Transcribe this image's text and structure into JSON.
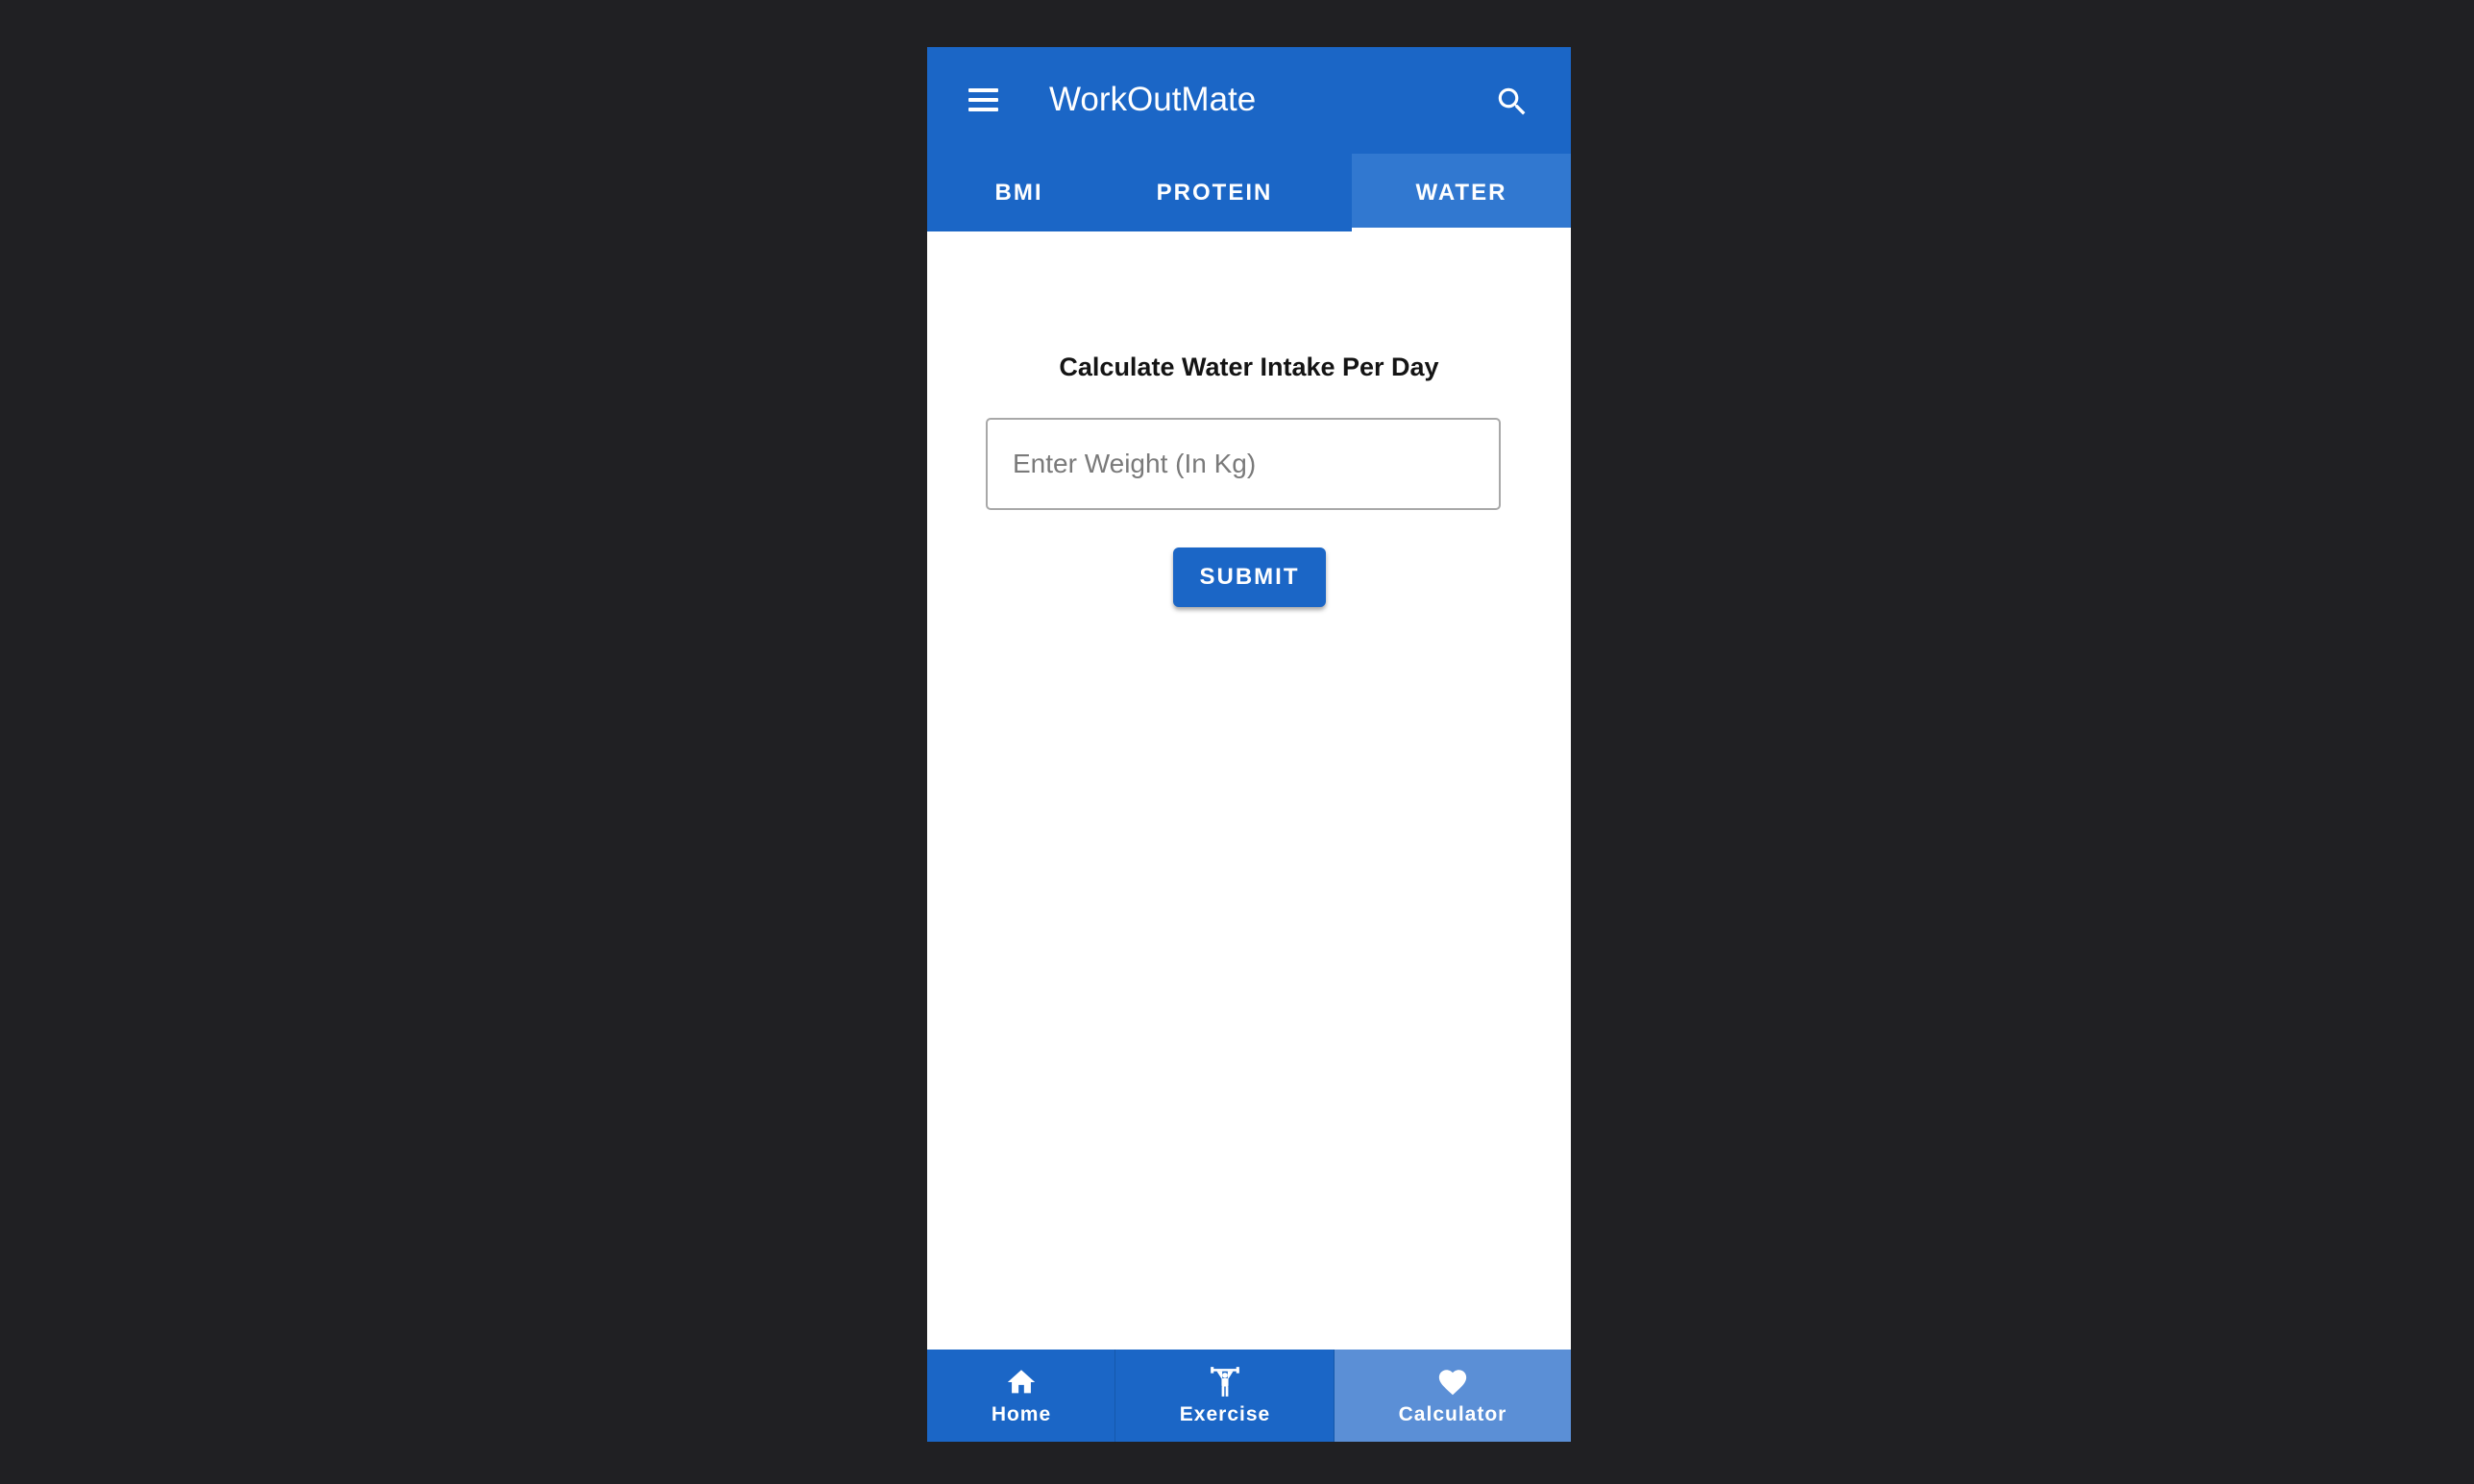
{
  "app": {
    "title": "WorkOutMate",
    "menu_icon": "menu-icon",
    "search_icon": "search-icon"
  },
  "tabs": [
    {
      "label": "BMI",
      "active": false
    },
    {
      "label": "PROTEIN",
      "active": false
    },
    {
      "label": "WATER",
      "active": true
    }
  ],
  "water": {
    "heading": "Calculate Water Intake Per Day",
    "weight_placeholder": "Enter Weight (In Kg)",
    "weight_value": "",
    "submit_label": "SUBMIT"
  },
  "bottom_nav": [
    {
      "label": "Home",
      "icon": "home-icon",
      "active": false
    },
    {
      "label": "Exercise",
      "icon": "weightlifter-icon",
      "active": false
    },
    {
      "label": "Calculator",
      "icon": "heart-icon",
      "active": true
    }
  ],
  "colors": {
    "primary": "#1b66c6",
    "active_tab": "#3178d0",
    "active_nav": "#5b8fd6",
    "background": "#202023"
  }
}
